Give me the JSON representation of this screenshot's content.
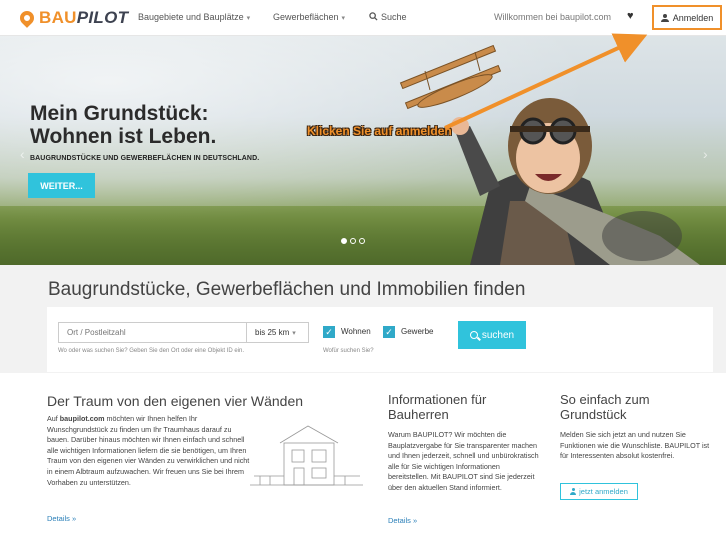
{
  "navbar": {
    "logo_part1": "BAU",
    "logo_part2": "PILOT",
    "menu": [
      {
        "label": "Baugebiete und Bauplätze",
        "caret": "▾"
      },
      {
        "label": "Gewerbeflächen",
        "caret": "▾"
      },
      {
        "label": "Suche"
      }
    ],
    "welcome": "Willkommen bei baupilot.com",
    "heart_glyph": "♥",
    "login_label": "Anmelden"
  },
  "hero": {
    "title_line1": "Mein Grundstück:",
    "title_line2": "Wohnen ist Leben.",
    "subtitle": "BAUGRUNDSTÜCKE UND GEWERBEFLÄCHEN IN DEUTSCHLAND.",
    "button": "WEITER...",
    "annotation": "Klicken Sie auf anmelden",
    "slide_count": 3,
    "active_slide": 1,
    "prev_glyph": "‹",
    "next_glyph": "›"
  },
  "search": {
    "title": "Baugrundstücke, Gewerbeflächen und Immobilien finden",
    "location_placeholder": "Ort / Postleitzahl",
    "location_value": "",
    "location_hint": "Wo oder was suchen Sie? Geben Sie den Ort oder eine Objekt ID ein.",
    "radius": "bis 25 km",
    "radius_caret": "▾",
    "checkbox_wohnen": {
      "label": "Wohnen",
      "checked": true
    },
    "checkbox_gewerbe": {
      "label": "Gewerbe",
      "checked": true
    },
    "check_glyph": "✓",
    "help_link": "Wofür suchen Sie?",
    "button": "suchen"
  },
  "content": {
    "col1": {
      "title": "Der Traum von den eigenen vier Wänden",
      "text_prefix": "Auf ",
      "text_bold": "baupilot.com",
      "text_rest": " möchten wir Ihnen helfen Ihr Wunschgrundstück zu finden um Ihr Traumhaus darauf zu bauen. Darüber hinaus möchten wir Ihnen einfach und schnell alle wichtigen Informationen liefern die sie benötigen, um Ihren Traum von den eigenen vier Wänden zu verwirklichen und nicht in einem Albtraum aufzuwachen. Wir freuen uns Sie bei Ihrem Vorhaben zu unterstützen.",
      "link": "Details »"
    },
    "col2": {
      "title": "Informationen für Bauherren",
      "text": "Warum BAUPILOT? Wir möchten die Bauplatzvergabe für Sie transparenter machen und Ihnen jederzeit, schnell und unbürokratisch alle für Sie wichtigen Informationen bereitstellen. Mit BAUPILOT sind Sie jederzeit über den aktuellen Stand informiert.",
      "link": "Details »"
    },
    "col3": {
      "title": "So einfach zum Grundstück",
      "text": "Melden Sie sich jetzt an und nutzen Sie Funktionen wie die Wunschliste. BAUPILOT ist für Interessenten absolut kostenfrei.",
      "button": "jetzt anmelden"
    }
  },
  "colors": {
    "brand_orange": "#f0902a",
    "brand_dark": "#3d4250",
    "accent_cyan": "#30c3dc",
    "link_blue": "#2a7fb8"
  },
  "icons": [
    "logo-pin-icon",
    "caret-down-icon",
    "search-icon",
    "heart-icon",
    "user-icon",
    "check-icon",
    "slide-arrow-left-icon",
    "slide-arrow-right-icon"
  ]
}
